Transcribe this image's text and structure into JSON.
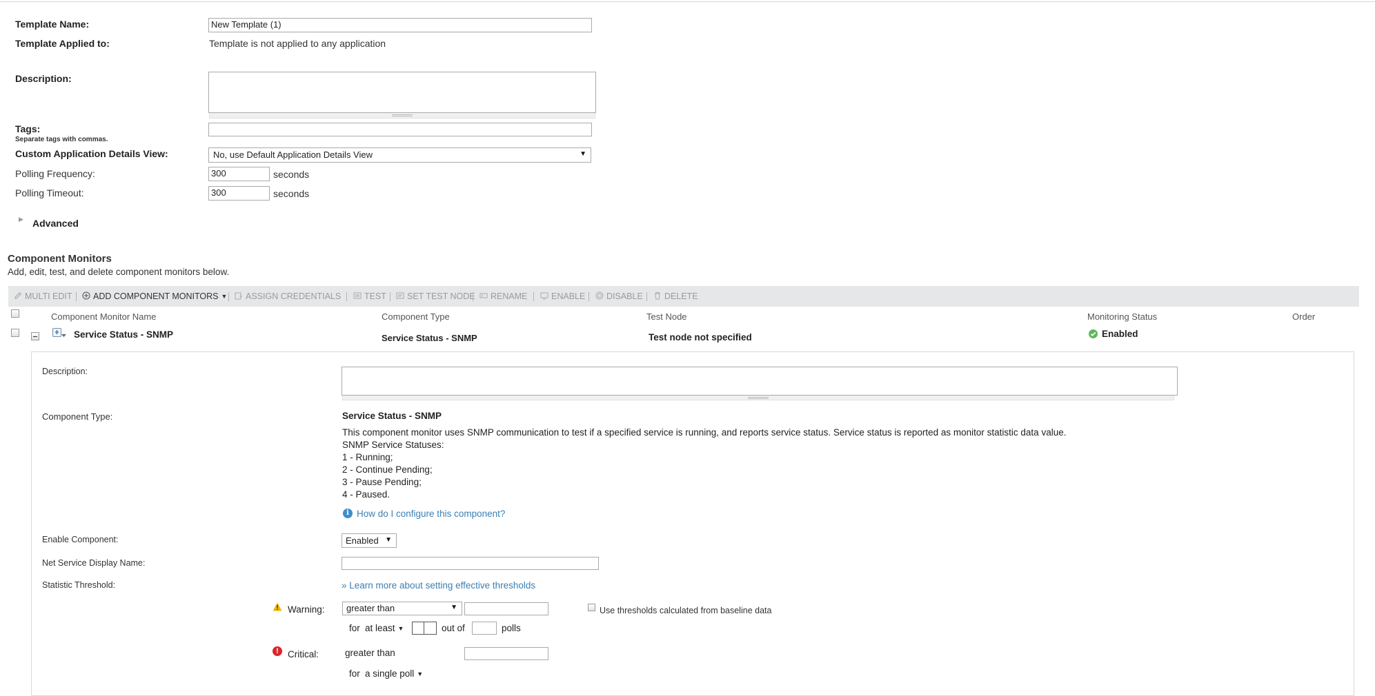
{
  "form": {
    "template_name_label": "Template Name:",
    "template_name_value": "New Template (1)",
    "applied_label": "Template Applied to:",
    "applied_value": "Template is not applied to any application",
    "description_label": "Description:",
    "tags_label": "Tags:",
    "tags_hint": "Separate tags with commas.",
    "custom_view_label": "Custom Application Details View:",
    "custom_view_value": "No, use Default Application Details View",
    "polling_frequency_label": "Polling Frequency:",
    "polling_frequency_value": "300",
    "polling_frequency_unit": "seconds",
    "polling_timeout_label": "Polling Timeout:",
    "polling_timeout_value": "300",
    "polling_timeout_unit": "seconds",
    "advanced_label": "Advanced"
  },
  "component_monitors": {
    "title": "Component Monitors",
    "subtitle": "Add, edit, test, and delete component monitors below.",
    "toolbar": {
      "multi_edit": "MULTI EDIT",
      "add": "ADD COMPONENT MONITORS",
      "assign_credentials": "ASSIGN CREDENTIALS",
      "test": "TEST",
      "set_test_node": "SET TEST NODE",
      "rename": "RENAME",
      "enable": "ENABLE",
      "disable": "DISABLE",
      "delete": "DELETE"
    },
    "columns": [
      "Component Monitor Name",
      "Component Type",
      "Test Node",
      "Monitoring Status",
      "Order"
    ],
    "row": {
      "name": "Service Status - SNMP",
      "type": "Service Status - SNMP",
      "test_node": "Test node not specified",
      "status": "Enabled"
    }
  },
  "detail": {
    "description_label": "Description:",
    "component_type_label": "Component Type:",
    "component_type_name": "Service Status - SNMP",
    "component_type_desc": "This component monitor uses SNMP communication to test if a specified service is running, and reports service status. Service status is reported as monitor statistic data value.",
    "statuses_title": "SNMP Service Statuses:",
    "statuses": [
      "1 - Running;",
      "2 - Continue Pending;",
      "3 - Pause Pending;",
      "4 - Paused."
    ],
    "help_link": "How do I configure this component?",
    "enable_label": "Enable Component:",
    "enable_value": "Enabled",
    "net_service_label": "Net Service Display Name:",
    "threshold_label": "Statistic Threshold:",
    "threshold_link": "» Learn more about setting effective thresholds",
    "warning_label": "Warning:",
    "warning_operator": "greater than",
    "baseline_label": "Use thresholds calculated from baseline data",
    "warning_for": "for",
    "warning_for_value": "at least",
    "out_of": "out of",
    "polls": "polls",
    "critical_label": "Critical:",
    "critical_operator": "greater than",
    "critical_for": "for",
    "critical_for_value": "a single poll"
  },
  "colors": {
    "toolbar_bg": "#e6e7e8",
    "link": "#3b7fb3",
    "enabled_green": "#5cb85c",
    "warning_yellow": "#f0b400",
    "critical_red": "#d9262b"
  }
}
